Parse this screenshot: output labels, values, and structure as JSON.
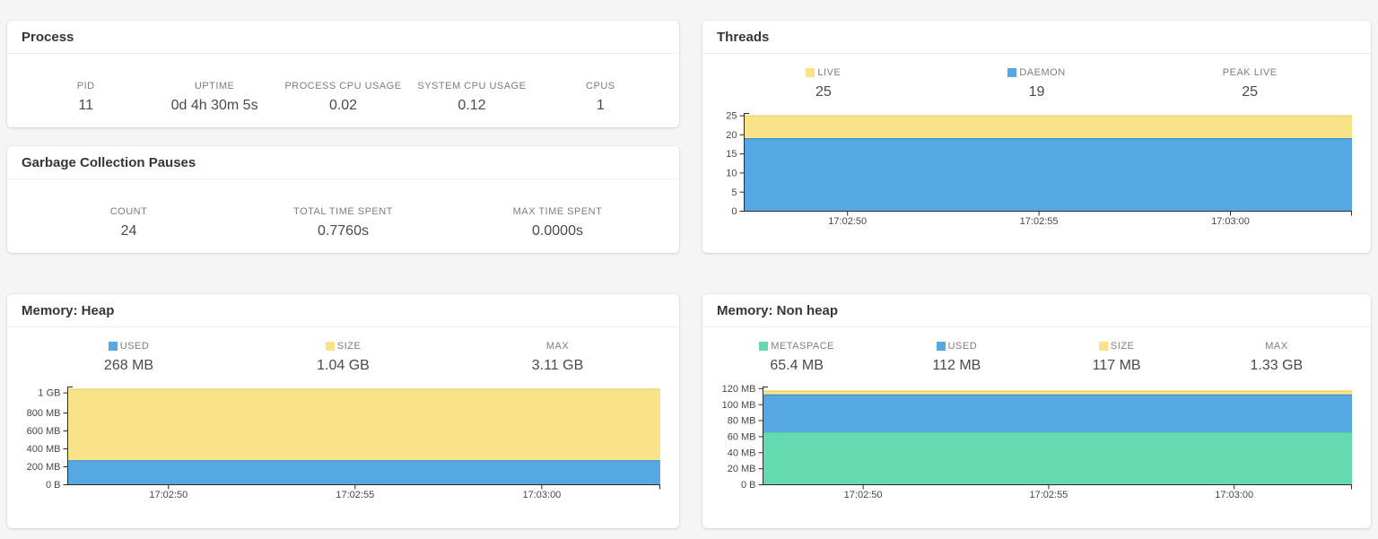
{
  "colors": {
    "yellow": "#fae287",
    "blue": "#56a8e2",
    "green": "#65dab1",
    "yellow_line": "#eccf6d",
    "blue_line": "#4093d2",
    "green_line": "#4fc9a1",
    "axis": "#2b2b2b",
    "tick_text": "#474747",
    "label_text": "#7d7d7d",
    "value_text": "#4a4a4a",
    "card_bg": "#ffffff",
    "page_bg": "#f5f5f5"
  },
  "panels": {
    "process": {
      "title": "Process",
      "stats": [
        {
          "label": "PID",
          "value": "11"
        },
        {
          "label": "UPTIME",
          "value": "0d 4h 30m 5s"
        },
        {
          "label": "PROCESS CPU USAGE",
          "value": "0.02"
        },
        {
          "label": "SYSTEM CPU USAGE",
          "value": "0.12"
        },
        {
          "label": "CPUS",
          "value": "1"
        }
      ]
    },
    "gc": {
      "title": "Garbage Collection Pauses",
      "stats": [
        {
          "label": "COUNT",
          "value": "24"
        },
        {
          "label": "TOTAL TIME SPENT",
          "value": "0.7760s"
        },
        {
          "label": "MAX TIME SPENT",
          "value": "0.0000s"
        }
      ]
    },
    "threads": {
      "title": "Threads",
      "stats": [
        {
          "label": "LIVE",
          "value": "25",
          "swatch": "yellow"
        },
        {
          "label": "DAEMON",
          "value": "19",
          "swatch": "blue"
        },
        {
          "label": "PEAK LIVE",
          "value": "25"
        }
      ]
    },
    "heap": {
      "title": "Memory: Heap",
      "stats": [
        {
          "label": "USED",
          "value": "268 MB",
          "swatch": "blue"
        },
        {
          "label": "SIZE",
          "value": "1.04 GB",
          "swatch": "yellow"
        },
        {
          "label": "MAX",
          "value": "3.11 GB"
        }
      ]
    },
    "nonheap": {
      "title": "Memory: Non heap",
      "stats": [
        {
          "label": "METASPACE",
          "value": "65.4 MB",
          "swatch": "green"
        },
        {
          "label": "USED",
          "value": "112 MB",
          "swatch": "blue"
        },
        {
          "label": "SIZE",
          "value": "117 MB",
          "swatch": "yellow"
        },
        {
          "label": "MAX",
          "value": "1.33 GB"
        }
      ]
    }
  },
  "chart_data": [
    {
      "id": "threads",
      "type": "area",
      "title": "Threads",
      "unit": "threads",
      "x": [
        "17:02:50",
        "17:02:55",
        "17:03:00"
      ],
      "xtick_fractions": [
        0.17,
        0.485,
        0.8
      ],
      "series": [
        {
          "name": "LIVE",
          "color_key": "yellow",
          "values": [
            25,
            25,
            25
          ]
        },
        {
          "name": "DAEMON",
          "color_key": "blue",
          "values": [
            19,
            19,
            19
          ]
        }
      ],
      "ylim": [
        0,
        25.6
      ],
      "yticks": [
        {
          "v": 0,
          "label": "0"
        },
        {
          "v": 5,
          "label": "5"
        },
        {
          "v": 10,
          "label": "10"
        },
        {
          "v": 15,
          "label": "15"
        },
        {
          "v": 20,
          "label": "20"
        },
        {
          "v": 25,
          "label": "25"
        }
      ],
      "legend_position": "top",
      "grid": false
    },
    {
      "id": "heap",
      "type": "area",
      "title": "Memory: Heap",
      "unit": "MB",
      "x": [
        "17:02:50",
        "17:02:55",
        "17:03:00"
      ],
      "xtick_fractions": [
        0.17,
        0.485,
        0.8
      ],
      "series": [
        {
          "name": "SIZE",
          "color_key": "yellow",
          "values": [
            1065,
            1065,
            1065
          ]
        },
        {
          "name": "USED",
          "color_key": "blue",
          "values": [
            268,
            268,
            268
          ]
        }
      ],
      "ylim": [
        0,
        1090
      ],
      "yticks": [
        {
          "v": 0,
          "label": "0 B"
        },
        {
          "v": 200,
          "label": "200 MB"
        },
        {
          "v": 400,
          "label": "400 MB"
        },
        {
          "v": 600,
          "label": "600 MB"
        },
        {
          "v": 800,
          "label": "800 MB"
        },
        {
          "v": 1024,
          "label": "1 GB"
        }
      ],
      "legend_position": "top",
      "grid": false
    },
    {
      "id": "nonheap",
      "type": "area",
      "title": "Memory: Non heap",
      "unit": "MB",
      "x": [
        "17:02:50",
        "17:02:55",
        "17:03:00"
      ],
      "xtick_fractions": [
        0.17,
        0.485,
        0.8
      ],
      "series": [
        {
          "name": "SIZE",
          "color_key": "yellow",
          "values": [
            117,
            117,
            117
          ]
        },
        {
          "name": "USED",
          "color_key": "blue",
          "values": [
            112,
            112,
            112
          ]
        },
        {
          "name": "METASPACE",
          "color_key": "green",
          "values": [
            65.4,
            65.4,
            65.4
          ]
        }
      ],
      "ylim": [
        0,
        122
      ],
      "yticks": [
        {
          "v": 0,
          "label": "0 B"
        },
        {
          "v": 20,
          "label": "20 MB"
        },
        {
          "v": 40,
          "label": "40 MB"
        },
        {
          "v": 60,
          "label": "60 MB"
        },
        {
          "v": 80,
          "label": "80 MB"
        },
        {
          "v": 100,
          "label": "100 MB"
        },
        {
          "v": 120,
          "label": "120 MB"
        }
      ],
      "legend_position": "top",
      "grid": false
    }
  ]
}
